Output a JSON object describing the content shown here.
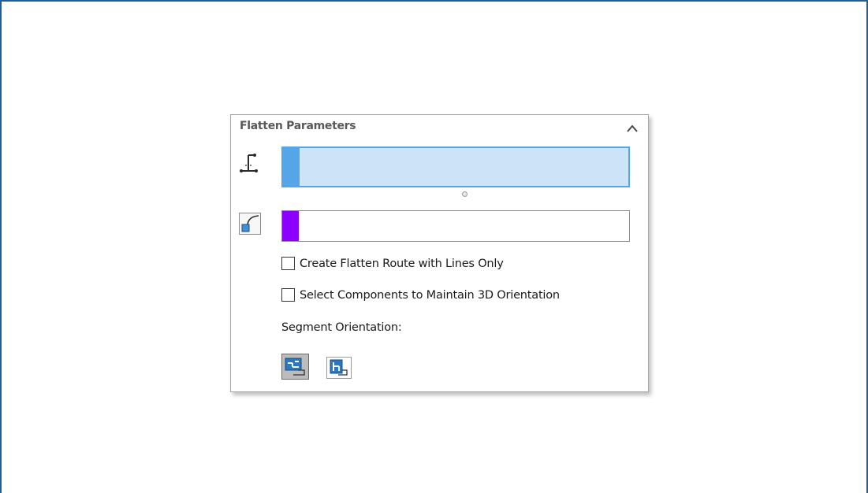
{
  "panel": {
    "title": "Flatten Parameters",
    "collapse_icon": "chevron-up-icon"
  },
  "selections": {
    "route": {
      "icon": "route-segment-icon",
      "tab_color": "#55a6e8",
      "background": "#cce4f7",
      "value": ""
    },
    "bend": {
      "icon": "bend-curve-icon",
      "tab_color": "#8b00ff",
      "value": ""
    }
  },
  "options": {
    "lines_only": {
      "label": "Create Flatten Route with Lines Only",
      "checked": false
    },
    "maintain_3d": {
      "label": "Select Components to Maintain 3D Orientation",
      "checked": false
    }
  },
  "segment_orientation": {
    "label": "Segment Orientation:",
    "buttons": [
      {
        "icon": "horizontal-align-icon",
        "selected": true
      },
      {
        "icon": "vertical-align-icon",
        "selected": false
      }
    ]
  },
  "colors": {
    "frame_border": "#1f5f95",
    "accent_blue": "#55a6e8",
    "accent_purple": "#8b00ff"
  }
}
